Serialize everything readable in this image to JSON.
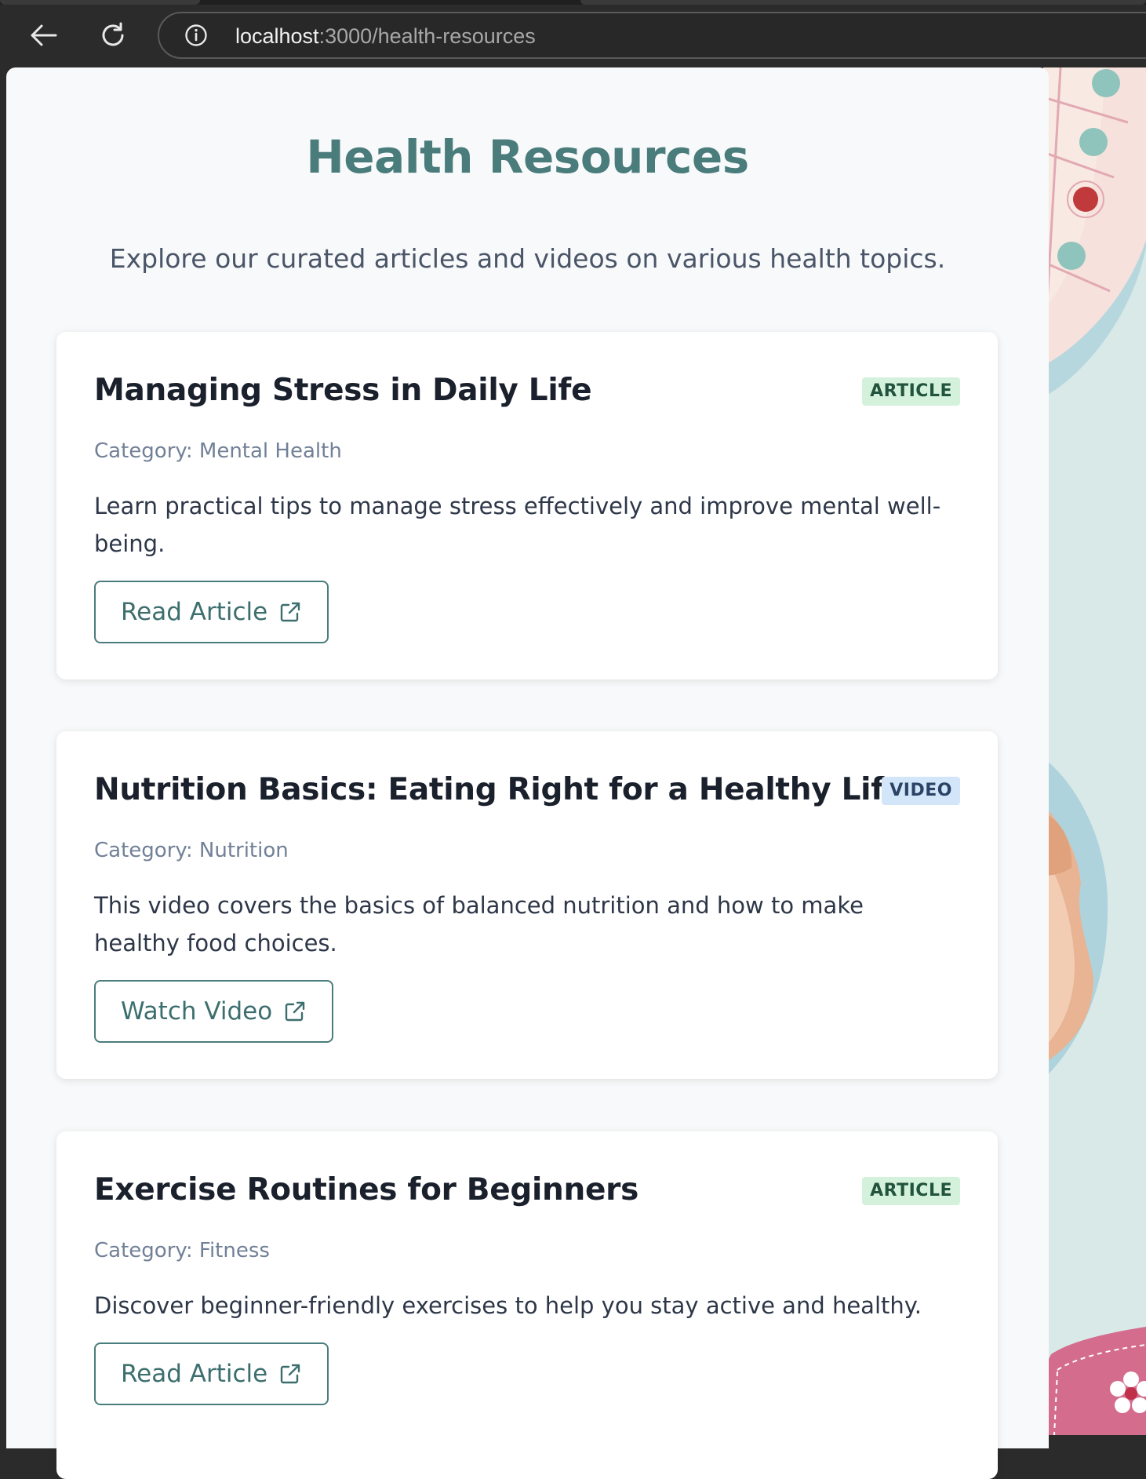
{
  "browser": {
    "url_host": "localhost",
    "url_path": ":3000/health-resources"
  },
  "page": {
    "title": "Health Resources",
    "subtitle": "Explore our curated articles and videos on various health topics."
  },
  "resources": [
    {
      "title": "Managing Stress in Daily Life",
      "type_badge": "ARTICLE",
      "category": "Category: Mental Health",
      "description": "Learn practical tips to manage stress effectively and improve mental well-being.",
      "action_label": "Read Article"
    },
    {
      "title": "Nutrition Basics: Eating Right for a Healthy Life",
      "type_badge": "VIDEO",
      "category": "Category: Nutrition",
      "description": "This video covers the basics of balanced nutrition and how to make healthy food choices.",
      "action_label": "Watch Video"
    },
    {
      "title": "Exercise Routines for Beginners",
      "type_badge": "ARTICLE",
      "category": "Category: Fitness",
      "description": "Discover beginner-friendly exercises to help you stay active and healthy.",
      "action_label": "Read Article"
    }
  ],
  "colors": {
    "accent": "#4a7c7c",
    "article_badge_bg": "#d4f1dc",
    "video_badge_bg": "#d3e5f9"
  },
  "icons": {
    "back": "arrow-left-icon",
    "reload": "reload-icon",
    "site_info": "info-icon",
    "external_link": "external-link-icon"
  }
}
